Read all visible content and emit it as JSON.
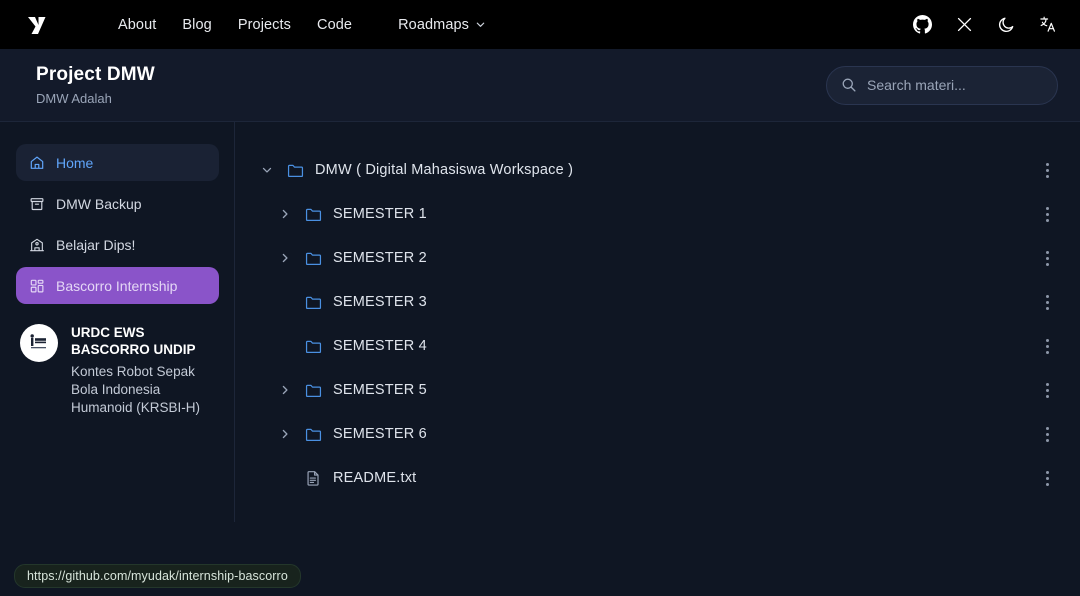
{
  "navbar": {
    "logo_name": "y-logo",
    "links": [
      {
        "label": "About",
        "name": "nav-link-about"
      },
      {
        "label": "Blog",
        "name": "nav-link-blog"
      },
      {
        "label": "Projects",
        "name": "nav-link-projects"
      },
      {
        "label": "Code",
        "name": "nav-link-code"
      }
    ],
    "dropdown": {
      "label": "Roadmaps",
      "icon": "chevron-down-icon"
    },
    "icons": [
      {
        "name": "github-icon",
        "label": "GitHub"
      },
      {
        "name": "x-twitter-icon",
        "label": "X"
      },
      {
        "name": "moon-icon",
        "label": "Dark mode"
      },
      {
        "name": "translate-icon",
        "label": "Language"
      }
    ]
  },
  "header": {
    "title": "Project DMW",
    "subtitle": "DMW Adalah",
    "search": {
      "placeholder": "Search materi...",
      "icon": "search-icon"
    }
  },
  "sidebar": {
    "items": [
      {
        "label": "Home",
        "icon": "home-icon",
        "state": "selected"
      },
      {
        "label": "DMW Backup",
        "icon": "archive-icon",
        "state": "default"
      },
      {
        "label": "Belajar Dips!",
        "icon": "building-icon",
        "state": "default"
      },
      {
        "label": "Bascorro Internship",
        "icon": "dashboard-grid-icon",
        "state": "active"
      }
    ],
    "project_card": {
      "avatar_name": "urdc-ews-avatar",
      "title": "URDC EWS BASCORRO UNDIP",
      "description": "Kontes Robot Sepak Bola Indonesia Humanoid (KRSBI-H)"
    }
  },
  "tree": {
    "rows": [
      {
        "label": "DMW ( Digital Mahasiswa Workspace )",
        "type": "folder",
        "depth": 0,
        "expanded": true,
        "has_children": true,
        "menu": "more-options-icon"
      },
      {
        "label": "SEMESTER 1",
        "type": "folder",
        "depth": 1,
        "expanded": false,
        "has_children": true,
        "menu": "more-options-icon"
      },
      {
        "label": "SEMESTER 2",
        "type": "folder",
        "depth": 1,
        "expanded": false,
        "has_children": true,
        "menu": "more-options-icon"
      },
      {
        "label": "SEMESTER 3",
        "type": "folder",
        "depth": 1,
        "expanded": false,
        "has_children": false,
        "menu": "more-options-icon"
      },
      {
        "label": "SEMESTER 4",
        "type": "folder",
        "depth": 1,
        "expanded": false,
        "has_children": false,
        "menu": "more-options-icon"
      },
      {
        "label": "SEMESTER 5",
        "type": "folder",
        "depth": 1,
        "expanded": false,
        "has_children": true,
        "menu": "more-options-icon"
      },
      {
        "label": "SEMESTER 6",
        "type": "folder",
        "depth": 1,
        "expanded": false,
        "has_children": true,
        "menu": "more-options-icon"
      },
      {
        "label": "README.txt",
        "type": "file",
        "depth": 1,
        "expanded": false,
        "has_children": false,
        "menu": "more-options-icon"
      }
    ]
  },
  "status_bar": {
    "url": "https://github.com/myudak/internship-bascorro"
  },
  "colors": {
    "navbar_bg": "#000000",
    "header_bg": "#131a2a",
    "page_bg": "#0f1623",
    "accent_purple": "#8a54c9",
    "accent_blue": "#60a5fa",
    "folder_blue": "#4a90e2"
  }
}
